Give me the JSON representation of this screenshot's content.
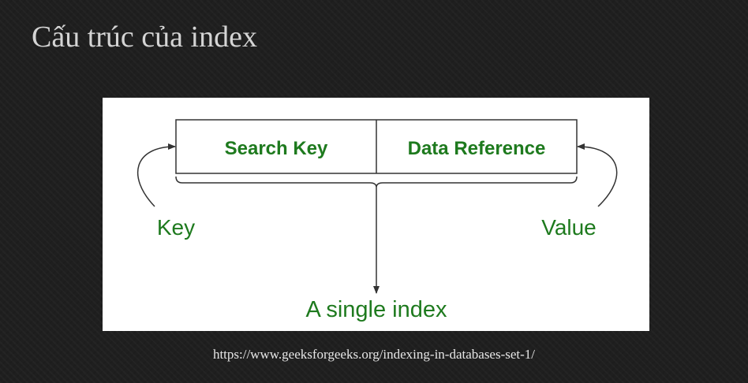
{
  "slide": {
    "title": "Cấu trúc của index",
    "source_url": "https://www.geeksforgeeks.org/indexing-in-databases-set-1/"
  },
  "diagram": {
    "cells": {
      "search_key": "Search Key",
      "data_reference": "Data Reference"
    },
    "labels": {
      "key": "Key",
      "value": "Value",
      "single_index": "A single index"
    },
    "colors": {
      "label_green": "#1e7a1e",
      "line": "#333333",
      "panel_background": "#ffffff",
      "slide_background": "#1f1f1f",
      "title_text": "#d4d4d4",
      "url_text": "#e6e6e6"
    }
  }
}
